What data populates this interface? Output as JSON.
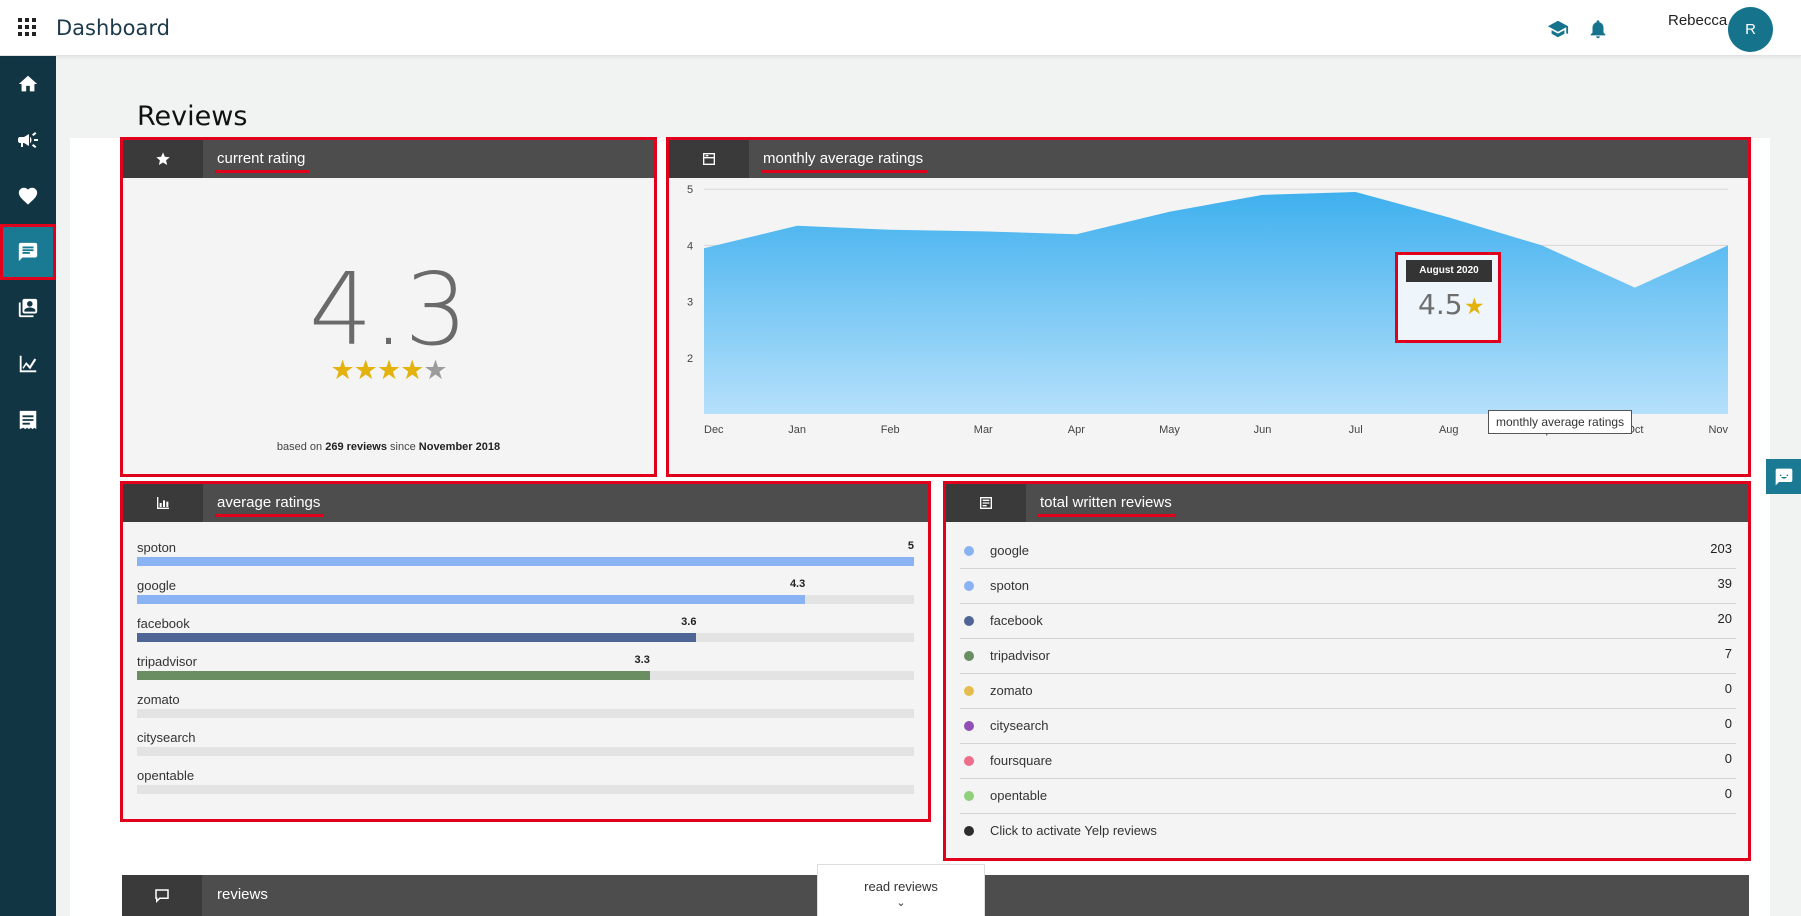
{
  "header": {
    "title": "Dashboard",
    "user_name": "Rebecca",
    "avatar_initial": "R"
  },
  "sidebar": {
    "items": [
      {
        "name": "home",
        "icon": "home-icon"
      },
      {
        "name": "campaigns",
        "icon": "megaphone-icon"
      },
      {
        "name": "favorites",
        "icon": "heart-icon"
      },
      {
        "name": "reviews",
        "icon": "chat-icon",
        "active": true
      },
      {
        "name": "contacts",
        "icon": "contacts-book-icon"
      },
      {
        "name": "analytics",
        "icon": "area-chart-icon"
      },
      {
        "name": "receipts",
        "icon": "receipt-icon"
      }
    ]
  },
  "page": {
    "title": "Reviews"
  },
  "current_rating": {
    "title": "current rating",
    "value": "4.3",
    "stars_filled": 4,
    "stars_total": 5,
    "based_prefix": "based on ",
    "based_count": "269 reviews",
    "based_mid": " since ",
    "based_since": "November 2018"
  },
  "monthly": {
    "title": "monthly average ratings",
    "tooltip": {
      "date": "August 2020",
      "value": "4.5"
    },
    "legend_label": "monthly average ratings"
  },
  "chart_data": {
    "type": "area",
    "x": [
      "Dec",
      "Jan",
      "Feb",
      "Mar",
      "Apr",
      "May",
      "Jun",
      "Jul",
      "Aug",
      "Sep",
      "Oct",
      "Nov"
    ],
    "series": [
      {
        "values": [
          3.95,
          4.35,
          4.28,
          4.25,
          4.2,
          4.6,
          4.9,
          4.95,
          4.5,
          4.0,
          3.25,
          4.0
        ]
      }
    ],
    "yticks": [
      2,
      3,
      4,
      5
    ],
    "ylim": [
      1,
      5.2
    ],
    "grid": true,
    "color": "#4bb4ee"
  },
  "average_ratings": {
    "title": "average ratings",
    "items": [
      {
        "label": "spoton",
        "value": 5,
        "display": "5",
        "color": "#8ab3f3"
      },
      {
        "label": "google",
        "value": 4.3,
        "display": "4.3",
        "color": "#8ab3f3"
      },
      {
        "label": "facebook",
        "value": 3.6,
        "display": "3.6",
        "color": "#4e6596"
      },
      {
        "label": "tripadvisor",
        "value": 3.3,
        "display": "3.3",
        "color": "#6a8e62"
      },
      {
        "label": "zomato",
        "value": 0,
        "display": "",
        "color": "#e3e3e3"
      },
      {
        "label": "citysearch",
        "value": 0,
        "display": "",
        "color": "#e3e3e3"
      },
      {
        "label": "opentable",
        "value": 0,
        "display": "",
        "color": "#e3e3e3"
      }
    ]
  },
  "total_written": {
    "title": "total written reviews",
    "items": [
      {
        "label": "google",
        "count": "203",
        "color": "#8ab3f3"
      },
      {
        "label": "spoton",
        "count": "39",
        "color": "#8ab3f3"
      },
      {
        "label": "facebook",
        "count": "20",
        "color": "#4e6596"
      },
      {
        "label": "tripadvisor",
        "count": "7",
        "color": "#6a8e62"
      },
      {
        "label": "zomato",
        "count": "0",
        "color": "#e5bd4e"
      },
      {
        "label": "citysearch",
        "count": "0",
        "color": "#8f4fb5"
      },
      {
        "label": "foursquare",
        "count": "0",
        "color": "#ee6d8b"
      },
      {
        "label": "opentable",
        "count": "0",
        "color": "#8fd07b"
      },
      {
        "label": "Click to activate Yelp reviews",
        "count": "",
        "color": "#2d2d2d"
      }
    ]
  },
  "reviews_section": {
    "title": "reviews",
    "read_label": "read reviews"
  }
}
